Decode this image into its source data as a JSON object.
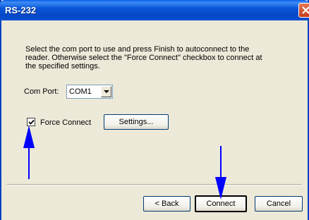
{
  "window": {
    "title": "RS-232"
  },
  "instructions": "Select the com port to use and press Finish to autoconnect to the reader. Otherwise select the \"Force Connect\" checkbox to connect at the specified settings.",
  "com_port": {
    "label": "Com Port:",
    "value": "COM1"
  },
  "force_connect": {
    "label": "Force Connect",
    "checked": true
  },
  "buttons": {
    "settings": "Settings...",
    "back": "< Back",
    "connect": "Connect",
    "cancel": "Cancel"
  },
  "colors": {
    "titlebar": "#0a56d8",
    "annotation_arrow": "#0000ff"
  }
}
